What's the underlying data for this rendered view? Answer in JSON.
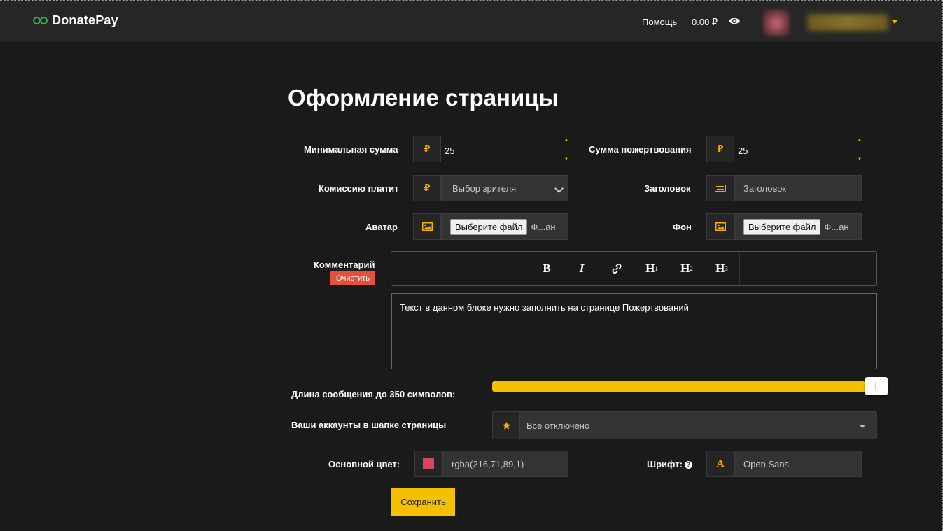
{
  "header": {
    "logo_text": "DonatePay",
    "help_label": "Помощь",
    "balance": "0.00 ₽"
  },
  "page": {
    "title": "Оформление страницы"
  },
  "form": {
    "min_sum": {
      "label": "Минимальная сумма",
      "currency": "₽",
      "value": "25"
    },
    "donation_sum": {
      "label": "Сумма пожертвования",
      "currency": "₽",
      "value": "25"
    },
    "commission": {
      "label": "Комиссию платит",
      "currency": "₽",
      "selected": "Выбор зрителя"
    },
    "title_field": {
      "label": "Заголовок",
      "placeholder": "Заголовок"
    },
    "avatar": {
      "label": "Аватар",
      "button": "Выберите файл",
      "file_name": "Ф...ан"
    },
    "background": {
      "label": "Фон",
      "button": "Выберите файл",
      "file_name": "Ф...ан"
    },
    "comment": {
      "label": "Комментарий",
      "clear_button": "Очистить",
      "toolbar": [
        {
          "name": "bold",
          "glyph": "B"
        },
        {
          "name": "italic",
          "glyph": "I"
        },
        {
          "name": "link",
          "glyph": "🔗"
        },
        {
          "name": "h1",
          "glyph": "H",
          "sup": "1"
        },
        {
          "name": "h2",
          "glyph": "H",
          "sup": "2"
        },
        {
          "name": "h3",
          "glyph": "H",
          "sup": "3"
        }
      ],
      "text": "Текст в данном блоке нужно заполнить на странице Пожертвований"
    },
    "message_length": {
      "label": "Длина сообщения до 350 символов:",
      "fill_percent": 97
    },
    "accounts": {
      "label": "Ваши аккаунты в шапке страницы",
      "selected": "Всё отключено"
    },
    "main_color": {
      "label": "Основной цвет:",
      "value": "rgba(216,71,89,1)",
      "swatch": "#d84759"
    },
    "font": {
      "label": "Шрифт:",
      "help": "?",
      "icon_letter": "A",
      "value": "Open Sans"
    },
    "save_button": "Сохранить"
  },
  "colors": {
    "accent": "#f5c000",
    "danger": "#e2513f",
    "brand_green": "#2cb34a"
  }
}
